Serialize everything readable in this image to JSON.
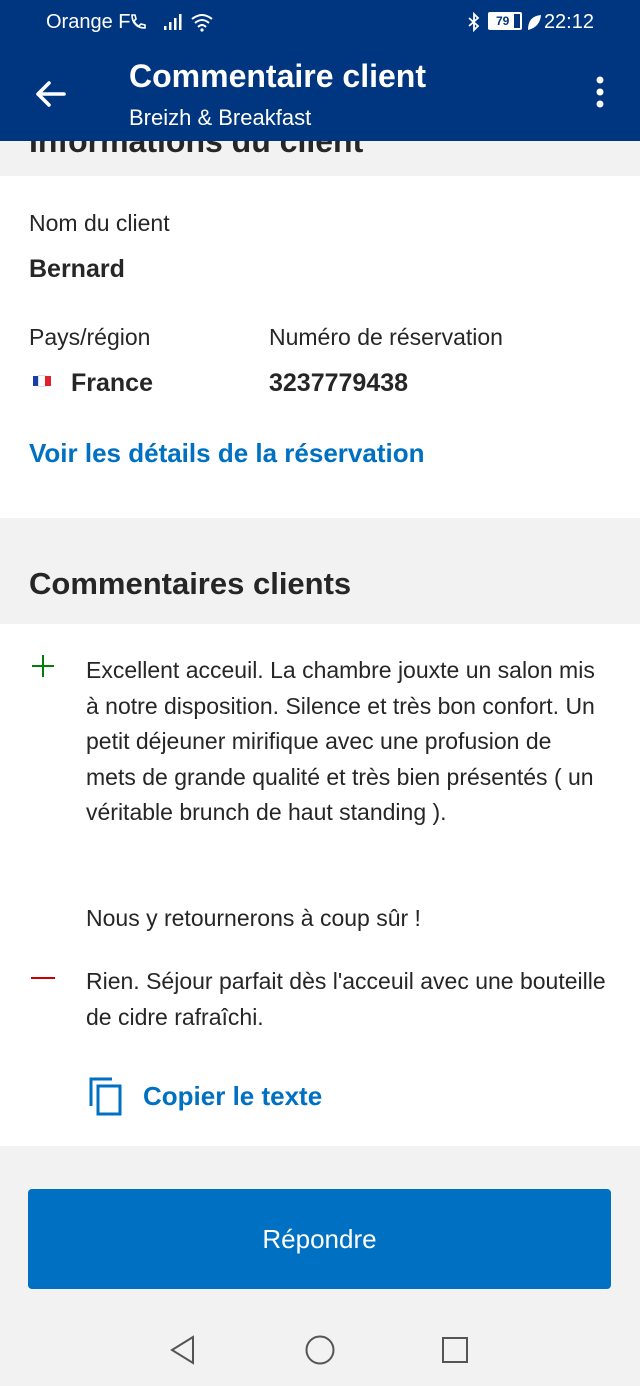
{
  "status_bar": {
    "carrier": "Orange F",
    "battery": "79",
    "time": "22:12"
  },
  "header": {
    "title": "Commentaire client",
    "subtitle": "Breizh & Breakfast"
  },
  "guest_info": {
    "section_title": "Informations du client",
    "name_label": "Nom du client",
    "name_value": "Bernard",
    "country_label": "Pays/région",
    "country_value": "France",
    "booking_label": "Numéro de réservation",
    "booking_value": "3237779438",
    "details_link": "Voir les détails de la réservation"
  },
  "reviews": {
    "section_title": "Commentaires clients",
    "positive_p1": "Excellent acceuil. La chambre jouxte un salon mis à notre disposition. Silence et très bon confort. Un petit déjeuner mirifique avec une profusion de mets de grande qualité et très bien présentés ( un véritable brunch de haut standing ).",
    "positive_p2": "Nous y retournerons à coup sûr !",
    "negative": "Rien. Séjour parfait dès l'acceuil avec une bouteille de cidre rafraîchi.",
    "copy_label": "Copier le texte"
  },
  "reply_button": "Répondre",
  "colors": {
    "brand": "#003580",
    "accent": "#0071c2",
    "positive": "#008009",
    "negative": "#cc0000"
  }
}
